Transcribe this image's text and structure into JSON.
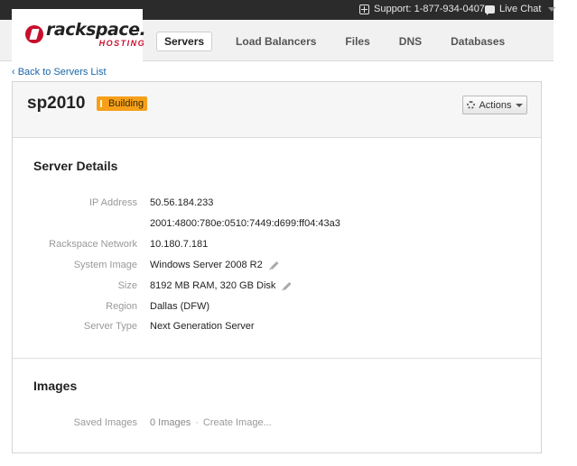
{
  "topbar": {
    "support_label": "Support: 1-877-934-0407",
    "livechat_label": "Live Chat"
  },
  "brand": {
    "name": "rackspace.",
    "sub": "HOSTING",
    "color": "#c8102e"
  },
  "nav": {
    "items": [
      {
        "label": "Servers",
        "active": true
      },
      {
        "label": "Load Balancers",
        "active": false
      },
      {
        "label": "Files",
        "active": false
      },
      {
        "label": "DNS",
        "active": false
      },
      {
        "label": "Databases",
        "active": false
      }
    ]
  },
  "breadcrumb": {
    "back_label": "‹ Back to Servers List"
  },
  "server": {
    "name": "sp2010",
    "status": "Building",
    "status_color": "#f6a01a",
    "actions_label": "Actions"
  },
  "details": {
    "title": "Server Details",
    "ip_label": "IP Address",
    "ip_v4": "50.56.184.233",
    "ip_v6": "2001:4800:780e:0510:7449:d699:ff04:43a3",
    "network_label": "Rackspace Network",
    "network_value": "10.180.7.181",
    "image_label": "System Image",
    "image_value": "Windows Server 2008 R2",
    "size_label": "Size",
    "size_value": "8192 MB RAM, 320 GB Disk",
    "region_label": "Region",
    "region_value": "Dallas (DFW)",
    "type_label": "Server Type",
    "type_value": "Next Generation Server"
  },
  "images": {
    "title": "Images",
    "saved_label": "Saved Images",
    "count": "0 Images",
    "separator": "·",
    "create_label": "Create Image..."
  }
}
